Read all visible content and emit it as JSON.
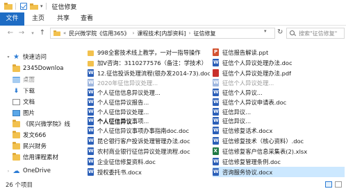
{
  "window": {
    "title": "征信修复"
  },
  "ribbon": {
    "tabs": [
      "文件",
      "主页",
      "共享",
      "查看"
    ]
  },
  "address": {
    "path": [
      "民兴微学院《信用365》",
      "课程技术[内部资料]",
      "征信修复"
    ],
    "prefix": "«"
  },
  "search": {
    "placeholder": "搜索\"征信修复\""
  },
  "nav": {
    "items": [
      {
        "label": "快速访问",
        "icon": "star-icon"
      },
      {
        "label": "2345Downloa",
        "icon": "folder-icon"
      },
      {
        "label": "桌面",
        "icon": "desktop-icon"
      },
      {
        "label": "下载",
        "icon": "download-icon"
      },
      {
        "label": "文档",
        "icon": "document-icon"
      },
      {
        "label": "图片",
        "icon": "picture-icon"
      },
      {
        "label": "《民兴微学院》线",
        "icon": "folder-icon"
      },
      {
        "label": "发文666",
        "icon": "folder-icon"
      },
      {
        "label": "民兴财务",
        "icon": "folder-icon"
      },
      {
        "label": "信用课程素材",
        "icon": "folder-icon"
      },
      {
        "label": "OneDrive",
        "icon": "cloud-icon"
      }
    ]
  },
  "files": {
    "left": [
      {
        "name": "998全套技术线上教学，一对一指导操作",
        "type": "folder"
      },
      {
        "name": "加V咨询：3110277576（备注：学技术）",
        "type": "folder"
      },
      {
        "name": "12.征信投诉处理流程(银办发2014-73).doc",
        "type": "word"
      },
      {
        "name": "2020年征信异议处理...",
        "type": "word"
      },
      {
        "name": "个人征信信息异议处理...",
        "type": "word"
      },
      {
        "name": "个人征信异议报告...",
        "type": "word"
      },
      {
        "name": "个人征信异议处理...",
        "type": "word"
      },
      {
        "name": "个人征信异议...",
        "type": "word"
      },
      {
        "name": "个人征信异议事项...",
        "type": "word"
      },
      {
        "name": "个人征信异议事项办事指南doc.doc",
        "type": "word"
      },
      {
        "name": "昆仑银行客户投诉处理管理办法.doc",
        "type": "word"
      },
      {
        "name": "农村商业银行征信异议处理流程.doc",
        "type": "word"
      },
      {
        "name": "企业征信修复资料.doc",
        "type": "word"
      },
      {
        "name": "授权委托书.docx",
        "type": "word"
      }
    ],
    "right": [
      {
        "name": "征信报告解读.ppt",
        "type": "ppt"
      },
      {
        "name": "征信个人异议处理办法.doc",
        "type": "word"
      },
      {
        "name": "征信个人异议处理办法.pdf",
        "type": "pdf"
      },
      {
        "name": "征信个人异议处理...",
        "type": "word"
      },
      {
        "name": "征信个人异议...",
        "type": "word"
      },
      {
        "name": "征信个人异议申请表.doc",
        "type": "word"
      },
      {
        "name": "征信异议...",
        "type": "word"
      },
      {
        "name": "征信异议...",
        "type": "word"
      },
      {
        "name": "征信修复话术.docx",
        "type": "word"
      },
      {
        "name": "征信修复技术（核心资料）.doc",
        "type": "word"
      },
      {
        "name": "征信修复客户信息采集表(2).xlsx",
        "type": "xls"
      },
      {
        "name": "征信修复管理条例.doc",
        "type": "word"
      },
      {
        "name": "咨询服务协议.docx",
        "type": "word",
        "selected": true
      }
    ]
  },
  "status": {
    "count": "26 个项目"
  }
}
